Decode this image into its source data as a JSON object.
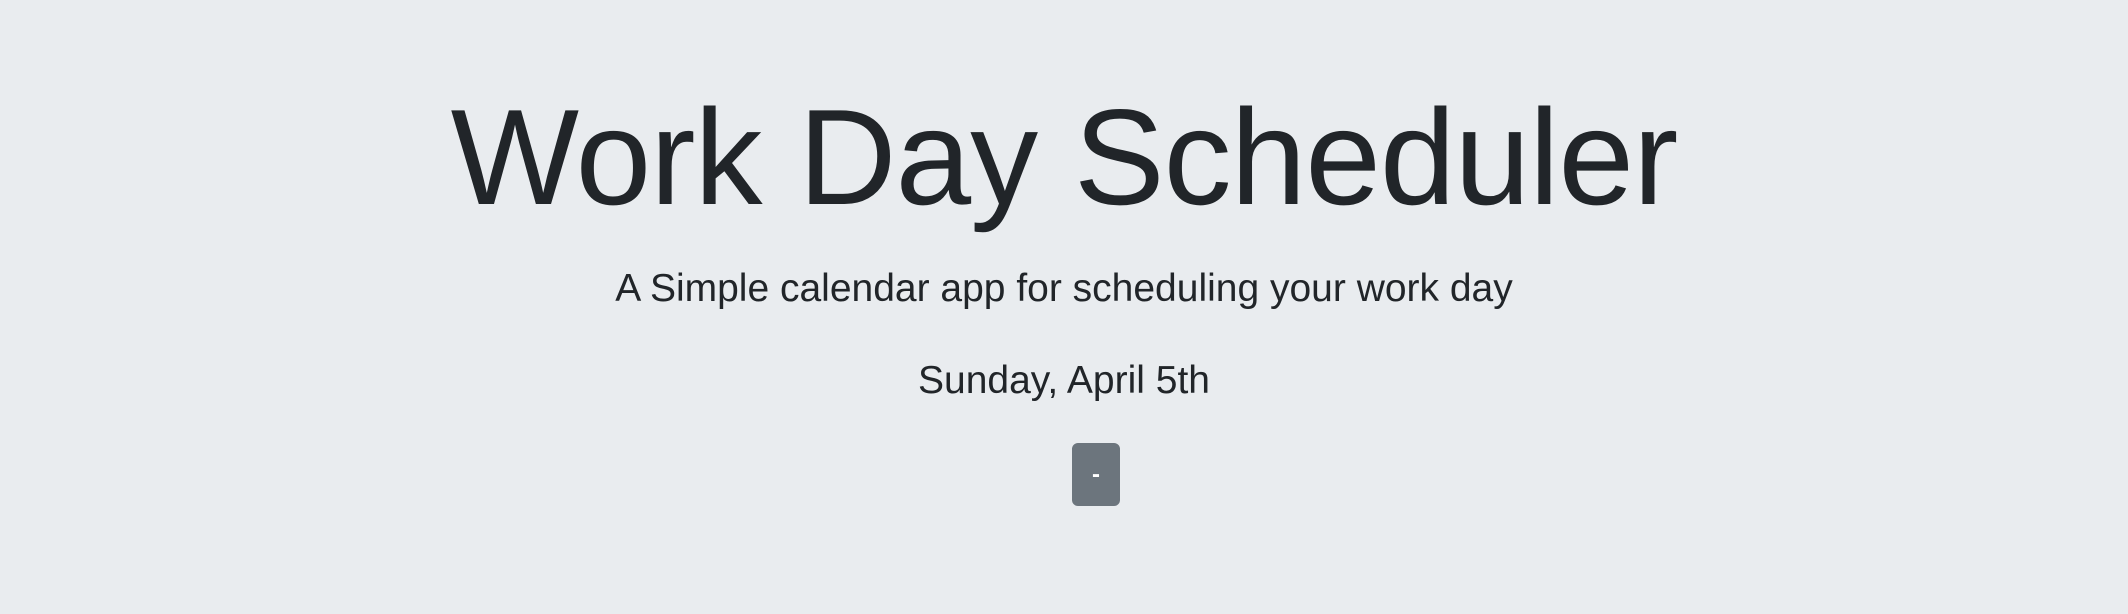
{
  "header": {
    "title": "Work Day Scheduler",
    "subtitle": "A Simple calendar app for scheduling your work day",
    "current_day": "Sunday, April 5th"
  },
  "actions": {
    "clear_label": "-"
  },
  "colors": {
    "background": "#e9ecef",
    "text": "#212529",
    "button": "#6c757d",
    "button_text": "#ffffff"
  }
}
